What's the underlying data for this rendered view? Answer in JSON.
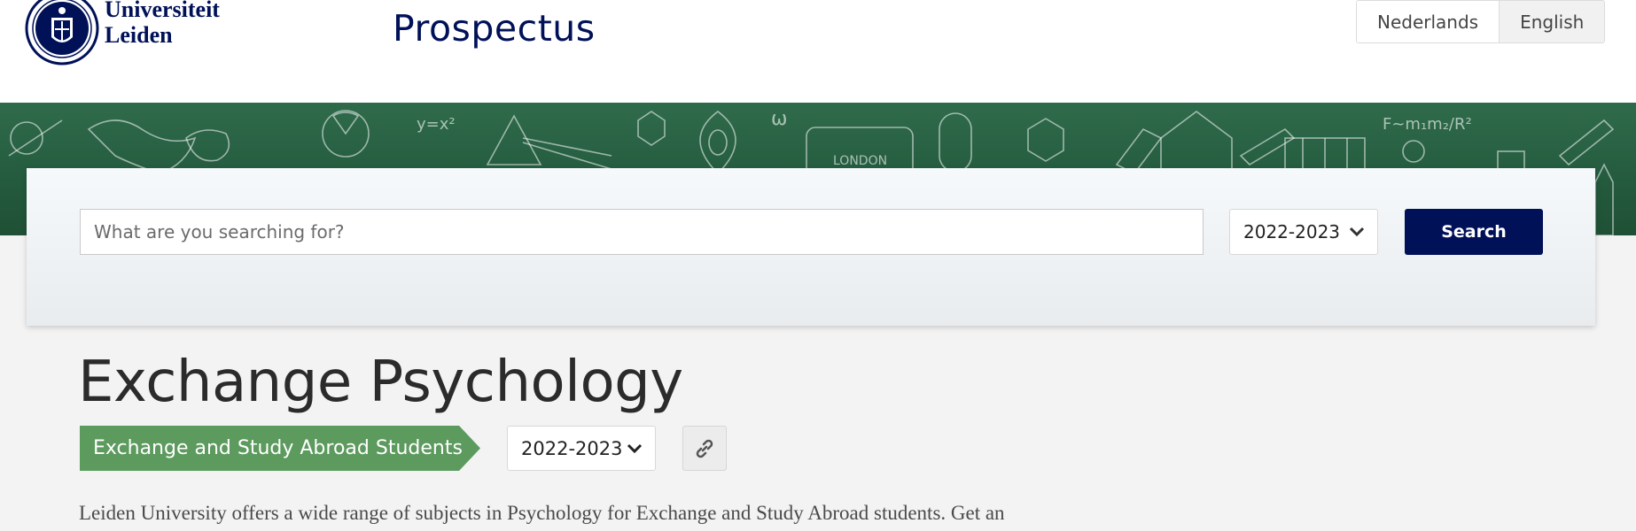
{
  "header": {
    "logo_line1": "Universiteit",
    "logo_line2": "Leiden",
    "site_title": "Prospectus",
    "languages": [
      {
        "label": "Nederlands",
        "active": false
      },
      {
        "label": "English",
        "active": true
      }
    ]
  },
  "search": {
    "placeholder": "What are you searching for?",
    "year": "2022-2023",
    "button_label": "Search"
  },
  "main": {
    "title": "Exchange Psychology",
    "category": "Exchange and Study Abroad Students",
    "year": "2022-2023",
    "intro": "Leiden University offers a wide range of subjects in Psychology for Exchange and Study Abroad students. Get an"
  },
  "colors": {
    "brand_navy": "#001158",
    "category_green": "#5c9a5e",
    "banner_green": "#2f6b4b"
  },
  "icons": {
    "seal": "university-seal-icon",
    "chevron": "chevron-down-icon",
    "link": "link-icon"
  }
}
